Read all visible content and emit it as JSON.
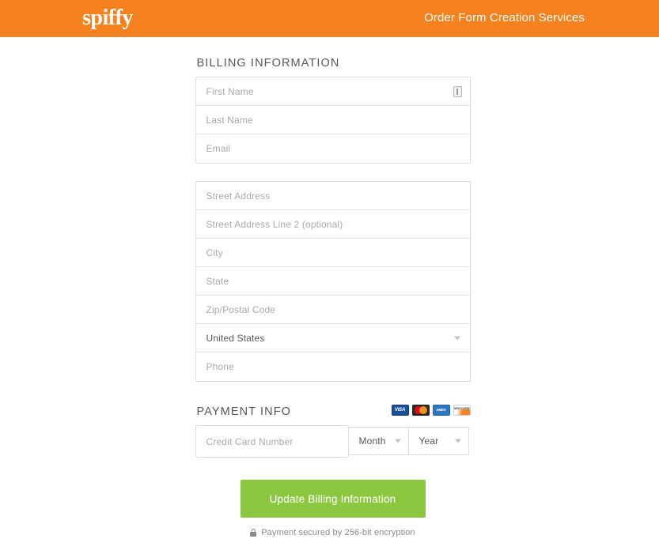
{
  "header": {
    "logo_text": "spiffy",
    "title": "Order Form Creation Services",
    "background_color": "#f5821f",
    "text_color": "#ffffff"
  },
  "billing": {
    "section_title": "BILLING INFORMATION",
    "name_fields": [
      {
        "name": "first-name",
        "placeholder": "First Name",
        "value": "",
        "has_autofill_icon": true
      },
      {
        "name": "last-name",
        "placeholder": "Last Name",
        "value": ""
      },
      {
        "name": "email",
        "placeholder": "Email",
        "value": ""
      }
    ],
    "address_fields": [
      {
        "name": "street-address",
        "placeholder": "Street Address",
        "value": ""
      },
      {
        "name": "street-address-2",
        "placeholder": "Street Address Line 2 (optional)",
        "value": ""
      },
      {
        "name": "city",
        "placeholder": "City",
        "value": ""
      },
      {
        "name": "state",
        "placeholder": "State",
        "value": ""
      },
      {
        "name": "zip",
        "placeholder": "Zip/Postal Code",
        "value": ""
      },
      {
        "name": "country",
        "placeholder": "United States",
        "value": "United States",
        "type": "select"
      },
      {
        "name": "phone",
        "placeholder": "Phone",
        "value": ""
      }
    ]
  },
  "payment": {
    "section_title": "PAYMENT INFO",
    "card_marks": [
      {
        "icon": "visa-card-icon",
        "label": "VISA"
      },
      {
        "icon": "mastercard-card-icon",
        "label": ""
      },
      {
        "icon": "amex-card-icon",
        "label": "AMERICAN EXPRESS"
      },
      {
        "icon": "discover-card-icon",
        "label": "DISCOVER"
      }
    ],
    "card_number": {
      "placeholder": "Credit Card Number",
      "value": ""
    },
    "expiry_month": {
      "placeholder": "Month",
      "value": "Month"
    },
    "expiry_year": {
      "placeholder": "Year",
      "value": "Year"
    }
  },
  "submit": {
    "label": "Update Billing Information",
    "color": "#8dc63f"
  },
  "footer": {
    "secure_icon": "lock-icon",
    "secure_text": "Payment secured by 256-bit encryption"
  }
}
